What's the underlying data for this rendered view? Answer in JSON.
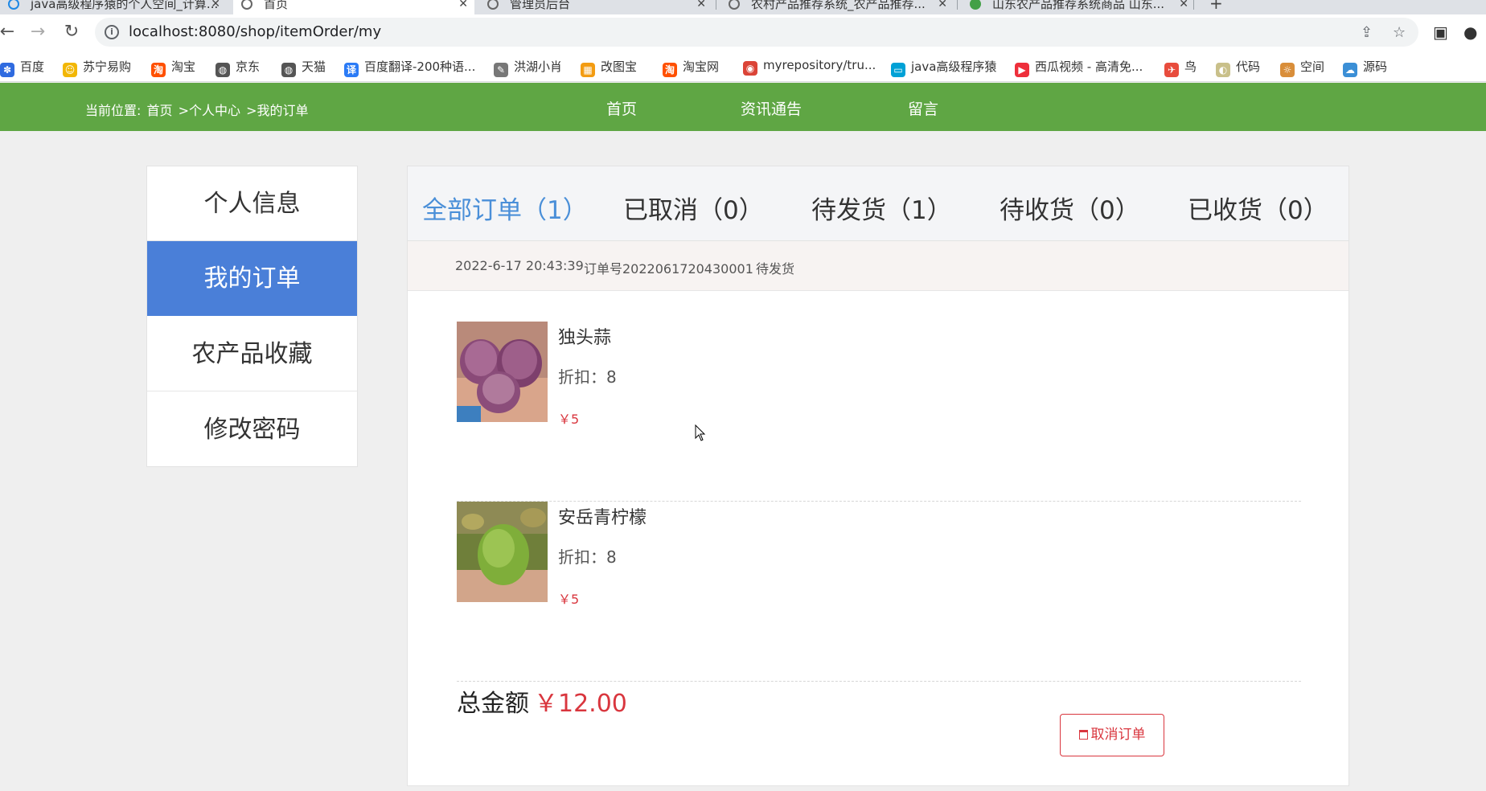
{
  "browser": {
    "tabs": [
      {
        "title": "java高级程序猿的个人空间_计算..."
      },
      {
        "title": "首页"
      },
      {
        "title": "管理员后台"
      },
      {
        "title": "农村产品推荐系统_农产品推荐..."
      },
      {
        "title": "山东农产品推荐系统商品 山东..."
      }
    ],
    "url": "localhost:8080/shop/itemOrder/my",
    "bookmarks": [
      {
        "label": "百度",
        "icon": "baidu-icon",
        "color": "#2f6be0"
      },
      {
        "label": "苏宁易购",
        "icon": "suning-icon",
        "color": "#f2b705"
      },
      {
        "label": "淘宝",
        "icon": "taobao-icon",
        "color": "#ff5000"
      },
      {
        "label": "京东",
        "icon": "globe-icon",
        "color": "#555555"
      },
      {
        "label": "天猫",
        "icon": "globe-icon",
        "color": "#555555"
      },
      {
        "label": "百度翻译-200种语...",
        "icon": "translate-icon",
        "color": "#2b7bf6"
      },
      {
        "label": "洪湖小肖",
        "icon": "bookmark-icon",
        "color": "#777777"
      },
      {
        "label": "改图宝",
        "icon": "image-icon",
        "color": "#f39c12"
      },
      {
        "label": "淘宝网",
        "icon": "taobao-icon",
        "color": "#ff5000"
      },
      {
        "label": "myrepository/tru...",
        "icon": "chrome-icon",
        "color": "#db4437"
      },
      {
        "label": "java高级程序猿",
        "icon": "bilibili-icon",
        "color": "#00a1d6"
      },
      {
        "label": "西瓜视频 - 高清免...",
        "icon": "xigua-icon",
        "color": "#ee2f3b"
      },
      {
        "label": "鸟",
        "icon": "bird-icon",
        "color": "#e84c3d"
      },
      {
        "label": "代码",
        "icon": "code-icon",
        "color": "#c9c08a"
      },
      {
        "label": "空间",
        "icon": "space-icon",
        "color": "#d98e3a"
      },
      {
        "label": "源码",
        "icon": "source-icon",
        "color": "#3b8fd6"
      }
    ]
  },
  "header": {
    "breadcrumb_prefix": "当前位置:",
    "breadcrumb": [
      "首页",
      ">个人中心",
      ">我的订单"
    ],
    "nav": [
      "首页",
      "资讯通告",
      "留言"
    ]
  },
  "sidebar": {
    "items": [
      {
        "label": "个人信息"
      },
      {
        "label": "我的订单"
      },
      {
        "label": "农产品收藏"
      },
      {
        "label": "修改密码"
      }
    ]
  },
  "order_tabs": [
    {
      "label": "全部订单（1）"
    },
    {
      "label": "已取消（0）"
    },
    {
      "label": "待发货（1）"
    },
    {
      "label": "待收货（0）"
    },
    {
      "label": "已收货（0）"
    }
  ],
  "order": {
    "datetime": "2022-6-17 20:43:39",
    "number": "订单号2022061720430001",
    "status": "待发货",
    "items": [
      {
        "name": "独头蒜",
        "discount": "折扣：8",
        "price": "￥5"
      },
      {
        "name": "安岳青柠檬",
        "discount": "折扣：8",
        "price": "￥5"
      }
    ],
    "total_label": "总金额",
    "total_amount": "￥12.00",
    "cancel_label": "取消订单"
  },
  "colors": {
    "header_green": "#5fa644",
    "active_blue": "#4a7fd8",
    "price_red": "#d9363e"
  }
}
